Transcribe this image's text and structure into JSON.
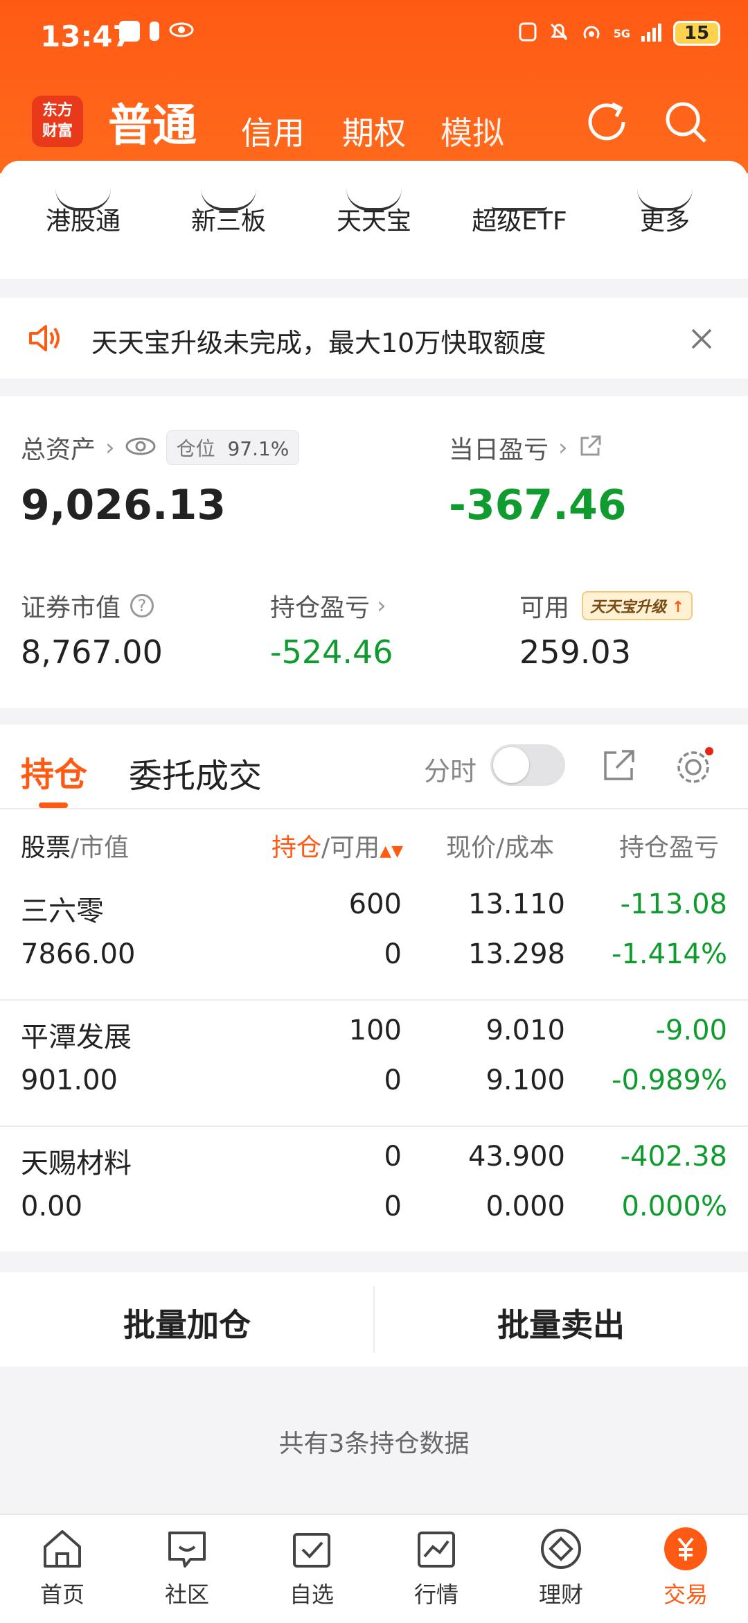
{
  "status_bar": {
    "time": "13:47",
    "battery": "15",
    "signal_text": "5G"
  },
  "header": {
    "logo_text": "东方\n财富",
    "tabs": [
      "普通",
      "信用",
      "期权",
      "模拟"
    ],
    "active_tab": "普通"
  },
  "shortcuts": [
    "港股通",
    "新三板",
    "天天宝",
    "超级ETF",
    "更多"
  ],
  "notice": {
    "text": "天天宝升级未完成，最大10万快取额度"
  },
  "assets": {
    "total_label": "总资产",
    "total_value": "9,026.13",
    "position_label": "仓位",
    "position_value": "97.1%",
    "daily_pl_label": "当日盈亏",
    "daily_pl_value": "-367.46",
    "market_value_label": "证券市值",
    "market_value": "8,767.00",
    "holding_pl_label": "持仓盈亏",
    "holding_pl_value": "-524.46",
    "available_label": "可用",
    "available_value": "259.03",
    "upgrade_badge": "天天宝升级"
  },
  "holdings": {
    "tab_active": "持仓",
    "tab_other": "委托成交",
    "fenshi_label": "分时",
    "columns": {
      "c1_a": "股票",
      "c1_b": "/市值",
      "c2_a": "持仓",
      "c2_b": "/可用",
      "c3": "现价/成本",
      "c4": "持仓盈亏"
    },
    "rows": [
      {
        "name": "三六零",
        "mv": "7866.00",
        "qty": "600",
        "avail": "0",
        "price": "13.110",
        "cost": "13.298",
        "pl": "-113.08",
        "plpct": "-1.414%"
      },
      {
        "name": "平潭发展",
        "mv": "901.00",
        "qty": "100",
        "avail": "0",
        "price": "9.010",
        "cost": "9.100",
        "pl": "-9.00",
        "plpct": "-0.989%"
      },
      {
        "name": "天赐材料",
        "mv": "0.00",
        "qty": "0",
        "avail": "0",
        "price": "43.900",
        "cost": "0.000",
        "pl": "-402.38",
        "plpct": "0.000%"
      }
    ]
  },
  "batch": {
    "add": "批量加仓",
    "sell": "批量卖出"
  },
  "summary": "共有3条持仓数据",
  "bottom_nav": [
    "首页",
    "社区",
    "自选",
    "行情",
    "理财",
    "交易"
  ],
  "colors": {
    "accent": "#ff5a14",
    "negative": "#0f9b2e"
  }
}
